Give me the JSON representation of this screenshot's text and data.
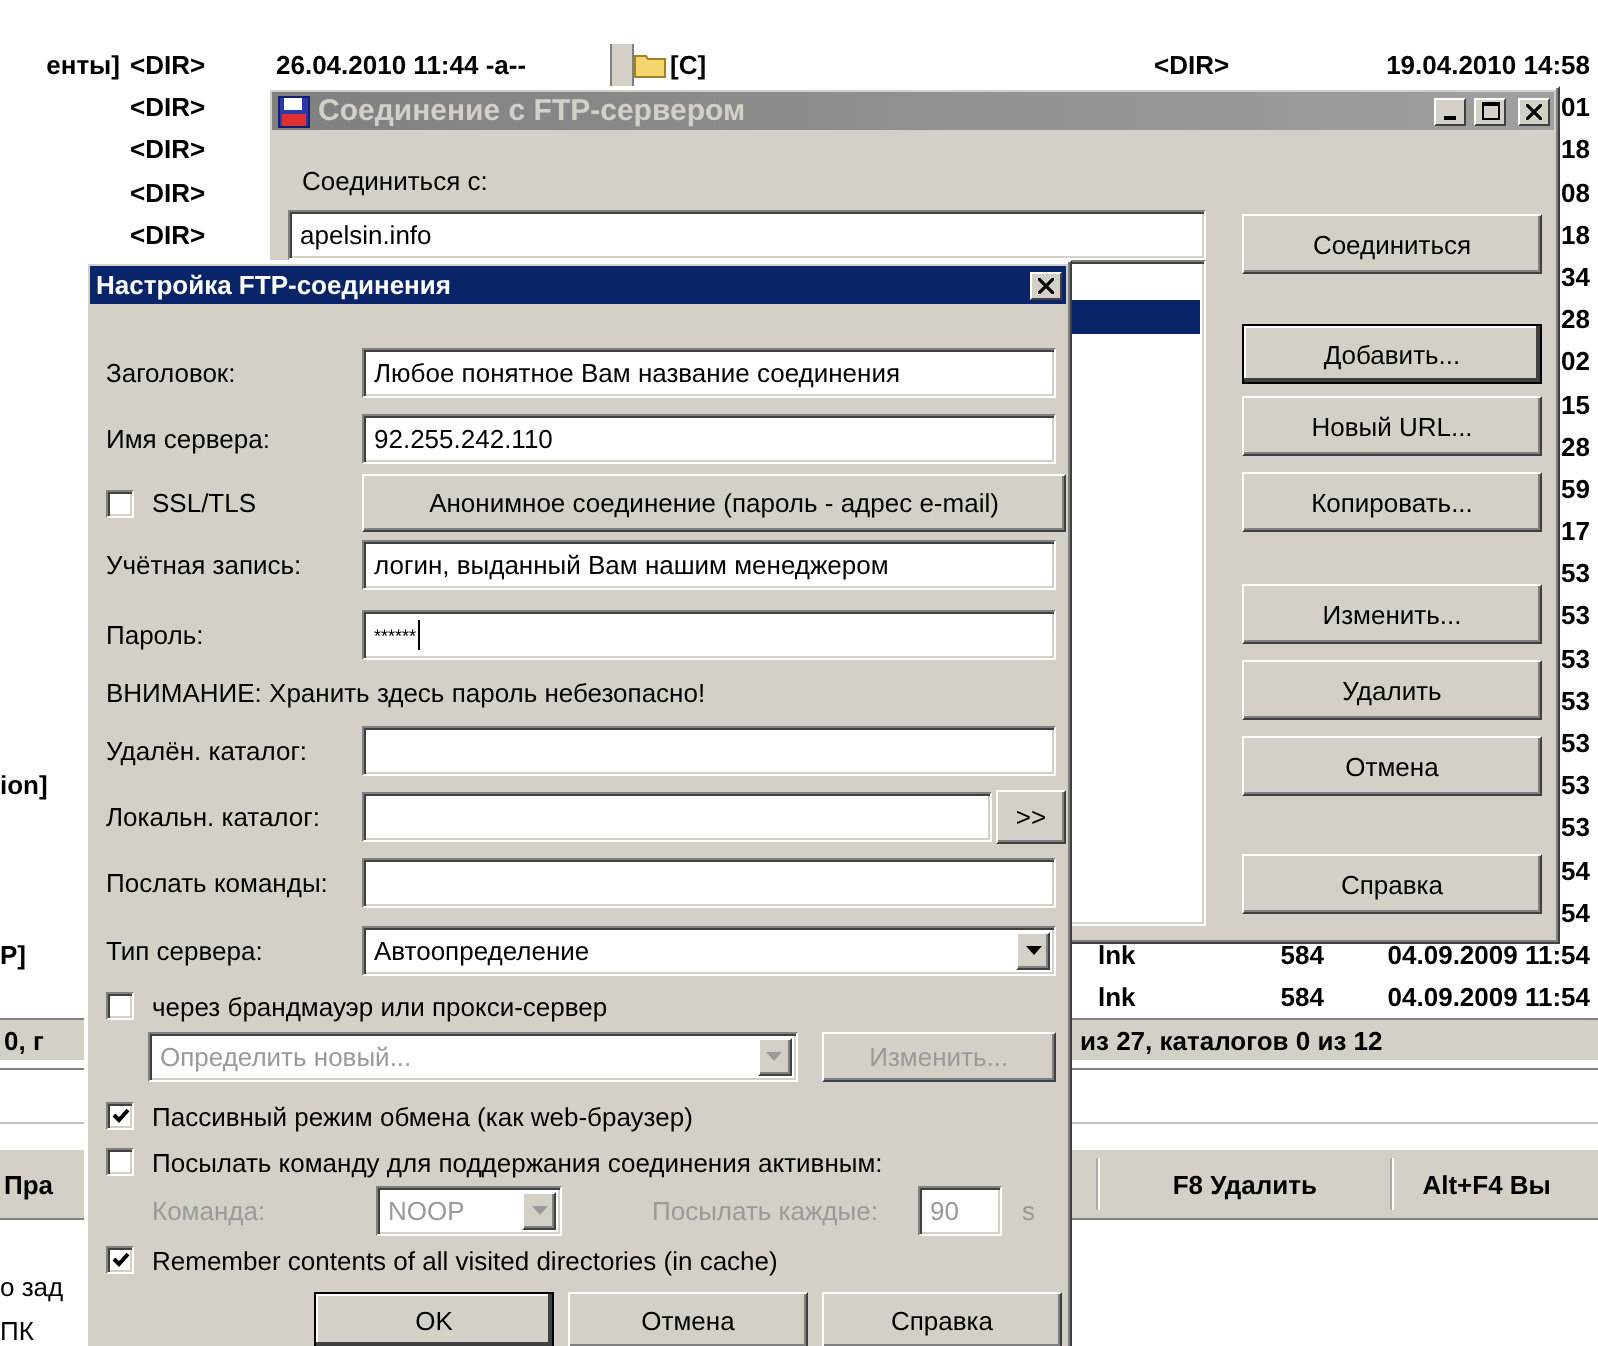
{
  "file_manager": {
    "left_panel": {
      "rows": [
        {
          "name": "енты]",
          "size": "<DIR>",
          "date": "26.04.2010 11:44 -a--"
        },
        {
          "size": "<DIR>"
        },
        {
          "size": "<DIR>"
        },
        {
          "size": "<DIR>"
        },
        {
          "size": "<DIR>"
        },
        {
          "name": "ion]"
        },
        {
          "name": "P]"
        }
      ],
      "status": "0, г"
    },
    "right_panel": {
      "rows": [
        {
          "kind": "folder",
          "name": "[C]",
          "size": "<DIR>",
          "date": "19.04.2010 14:58"
        },
        {
          "kind": "tail",
          "text": "01"
        },
        {
          "kind": "tail",
          "text": "18"
        },
        {
          "kind": "tail",
          "text": "08"
        },
        {
          "kind": "tail",
          "text": "18"
        },
        {
          "kind": "tail",
          "text": "34"
        },
        {
          "kind": "tail",
          "text": "28"
        },
        {
          "kind": "tail",
          "text": "02"
        },
        {
          "kind": "tail",
          "text": "15"
        },
        {
          "kind": "tail",
          "text": "28"
        },
        {
          "kind": "tail",
          "text": "59"
        },
        {
          "kind": "tail",
          "text": "17"
        },
        {
          "kind": "tail",
          "text": "53"
        },
        {
          "kind": "tail",
          "text": "53"
        },
        {
          "kind": "tail",
          "text": "53"
        },
        {
          "kind": "tail",
          "text": "53"
        },
        {
          "kind": "tail",
          "text": "53"
        },
        {
          "kind": "tail",
          "text": "53"
        },
        {
          "kind": "tail",
          "text": "53"
        },
        {
          "kind": "tail",
          "text": "54"
        },
        {
          "kind": "tail",
          "text": "54"
        },
        {
          "kind": "file",
          "ext": "lnk",
          "size": "584",
          "date": "04.09.2009 11:54"
        },
        {
          "kind": "file",
          "ext": "lnk",
          "size": "584",
          "date": "04.09.2009 11:54"
        }
      ],
      "status": "из 27, каталогов 0 из 12"
    },
    "button_bar": [
      "Пра",
      "F8 Удалить",
      "Alt+F4 Вы"
    ],
    "behind_text": [
      "о зад",
      "ПК"
    ]
  },
  "ftp_window": {
    "title": "Соединение с FTP-сервером",
    "connect_label": "Соединиться с:",
    "address": "apelsin.info",
    "list": [
      {
        "selected": false
      },
      {
        "selected": true
      }
    ],
    "buttons": [
      {
        "label": "Соединиться",
        "default": false
      },
      {
        "label": "Добавить...",
        "default": true
      },
      {
        "label": "Новый URL...",
        "default": false
      },
      {
        "label": "Копировать...",
        "default": false
      },
      {
        "label": "Изменить...",
        "default": false
      },
      {
        "label": "Удалить",
        "default": false
      },
      {
        "label": "Отмена",
        "default": false
      },
      {
        "label": "Справка",
        "default": false
      }
    ]
  },
  "settings_dialog": {
    "title": "Настройка FTP-соединения",
    "title_field": {
      "label": "Заголовок:",
      "value": "Любое понятное Вам название соединения"
    },
    "server_field": {
      "label": "Имя сервера:",
      "value": "92.255.242.110"
    },
    "ssl": {
      "label": "SSL/TLS",
      "checked": false
    },
    "anonymous_button": "Анонимное соединение (пароль - адрес e-mail)",
    "account": {
      "label": "Учётная запись:",
      "value": "логин, выданный Вам нашим менеджером"
    },
    "password": {
      "label": "Пароль:",
      "value": "******"
    },
    "warning": "ВНИМАНИЕ: Хранить здесь пароль небезопасно!",
    "remote_dir": {
      "label": "Удалён. каталог:"
    },
    "local_dir": {
      "label": "Локальн. каталог:",
      "browse_button": ">>"
    },
    "commands": {
      "label": "Послать команды:"
    },
    "server_type": {
      "label": "Тип сервера:",
      "value": "Автоопределение"
    },
    "firewall": {
      "label": "через брандмауэр или прокси-сервер",
      "checked": false
    },
    "proxy": {
      "value": "Определить новый...",
      "disabled": true,
      "edit_button": "Изменить..."
    },
    "passive": {
      "label": "Пассивный режим обмена (как web-браузер)",
      "checked": true
    },
    "keepalive": {
      "label": "Посылать команду для поддержания соединения активным:",
      "checked": false
    },
    "keepalive_options": {
      "disabled": true,
      "command_label": "Команда:",
      "command": "NOOP",
      "interval_label": "Посылать каждые:",
      "interval": "90",
      "unit": "s"
    },
    "cache": {
      "label": "Remember contents of all visited directories (in cache)",
      "checked": true
    },
    "buttons": [
      {
        "label": "OK",
        "default": true
      },
      {
        "label": "Отмена",
        "default": false
      },
      {
        "label": "Справка",
        "default": false
      }
    ]
  }
}
